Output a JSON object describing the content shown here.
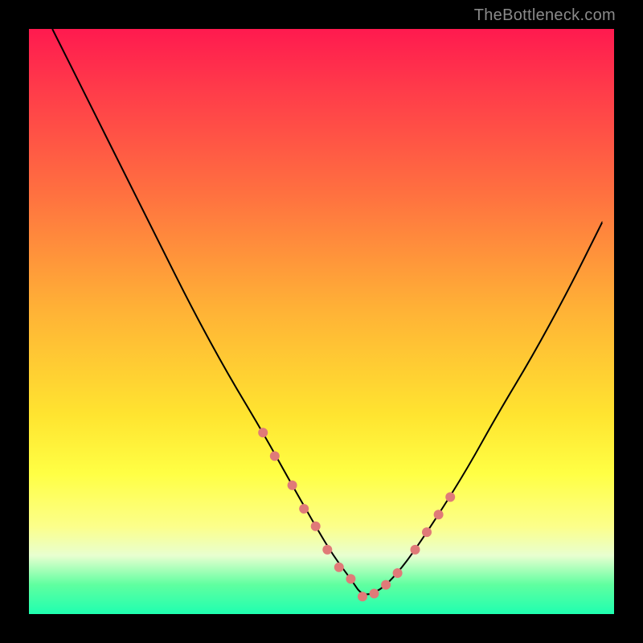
{
  "watermark": "TheBottleneck.com",
  "colors": {
    "frame": "#000000",
    "curve": "#000000",
    "dots": "#e07a78",
    "gradient_top": "#ff1a4f",
    "gradient_bottom": "#1fffb0"
  },
  "chart_data": {
    "type": "line",
    "title": "",
    "xlabel": "",
    "ylabel": "",
    "xlim": [
      0,
      100
    ],
    "ylim": [
      0,
      100
    ],
    "grid": false,
    "notes": "Axes are unlabeled; x and y read as 0–100 % of plot area. y=0 is the bottom (green) edge, y=100 the top (red) edge. Single V-shaped curve with minimum near x≈57, y≈3. Salmon dots mark points along the lower portion of both arms.",
    "series": [
      {
        "name": "bottleneck-curve",
        "x": [
          4,
          10,
          16,
          22,
          28,
          34,
          40,
          45,
          49,
          52,
          55,
          57,
          60,
          63,
          66,
          70,
          75,
          80,
          86,
          92,
          98
        ],
        "y": [
          100,
          88,
          76,
          64,
          52,
          41,
          31,
          22,
          15,
          10,
          6,
          3,
          4,
          7,
          11,
          17,
          25,
          34,
          44,
          55,
          67
        ]
      }
    ],
    "dots": {
      "name": "highlighted-points",
      "x": [
        40,
        42,
        45,
        47,
        49,
        51,
        53,
        55,
        57,
        59,
        61,
        63,
        66,
        68,
        70,
        72
      ],
      "y": [
        31,
        27,
        22,
        18,
        15,
        11,
        8,
        6,
        3,
        3.5,
        5,
        7,
        11,
        14,
        17,
        20
      ]
    }
  }
}
